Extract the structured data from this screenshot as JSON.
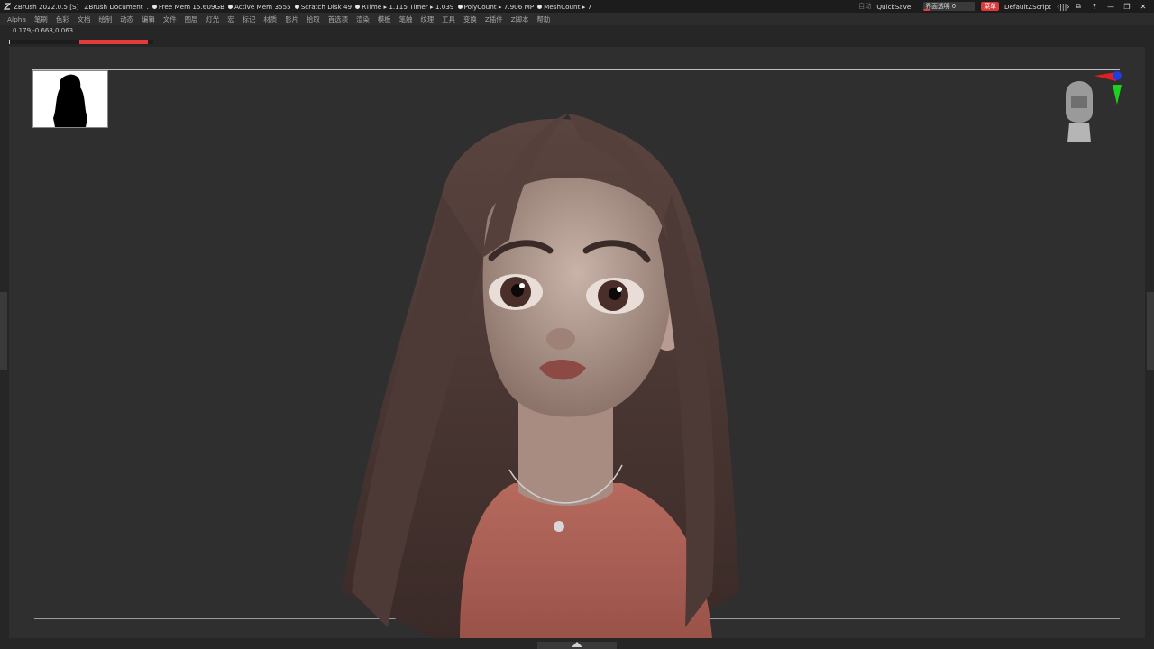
{
  "titlebar": {
    "app": "ZBrush 2022.0.5 [S]",
    "document": "ZBrush Document",
    "stats": [
      "Free Mem 15.609GB",
      "Active Mem 3555",
      "Scratch Disk 49",
      "RTime ▸ 1.115 Timer ▸ 1.039",
      "PolyCount ▸ 7.906 MP",
      "MeshCount ▸ 7"
    ],
    "auto_label": "自动",
    "quicksave": "QuickSave",
    "transparency_label": "界面透明 0",
    "transparency_value": 0,
    "menu_badge": "菜单",
    "script": "DefaultZScript"
  },
  "menubar": {
    "items": [
      "Alpha",
      "笔刷",
      "色彩",
      "文档",
      "绘制",
      "动态",
      "编辑",
      "文件",
      "图层",
      "灯光",
      "宏",
      "标记",
      "材质",
      "影片",
      "拾取",
      "首选项",
      "渲染",
      "模板",
      "笔触",
      "纹理",
      "工具",
      "变换",
      "Z插件",
      "Z脚本",
      "帮助"
    ]
  },
  "status": {
    "coordinates": "0.179,-0.668,0.063",
    "progress_fraction": 0.47
  },
  "colors": {
    "accent": "#e33b3b",
    "background": "#262626",
    "canvas": "#2f2f2f"
  },
  "icons": {
    "logo": "zbrush-logo-icon",
    "gizmo": "orientation-gizmo-icon",
    "thumbnail": "silhouette-thumbnail",
    "bottom_toggle": "collapse-tray-icon"
  }
}
